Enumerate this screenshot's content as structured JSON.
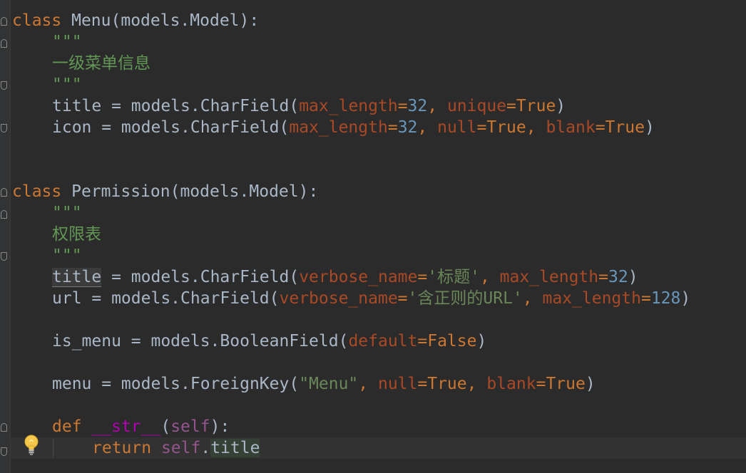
{
  "code": {
    "line1": {
      "kw": "class",
      "name": "Menu",
      "rest": "(models.Model):"
    },
    "line2": "\"\"\"",
    "line3": "一级菜单信息",
    "line4": "\"\"\"",
    "line5": {
      "lhs": "title",
      "mid": " = models.CharField(",
      "p1": "max_length",
      "eq1": "=",
      "n1": "32",
      "sep1": ", ",
      "p2": "unique",
      "eq2": "=",
      "v2": "True",
      "end": ")"
    },
    "line6": {
      "lhs": "icon",
      "mid": " = models.CharField(",
      "p1": "max_length",
      "eq1": "=",
      "n1": "32",
      "sep1": ", ",
      "p2": "null",
      "eq2": "=",
      "v2": "True",
      "sep2": ", ",
      "p3": "blank",
      "eq3": "=",
      "v3": "True",
      "end": ")"
    },
    "line7": {
      "kw": "class",
      "name": "Permission",
      "rest": "(models.Model):"
    },
    "line8": "\"\"\"",
    "line9": "权限表",
    "line10": "\"\"\"",
    "line11": {
      "lhs": "title",
      "mid": " = models.CharField(",
      "p1": "verbose_name",
      "eq1": "=",
      "s1": "'标题'",
      "sep1": ", ",
      "p2": "max_length",
      "eq2": "=",
      "n2": "32",
      "end": ")"
    },
    "line12": {
      "lhs": "url",
      "mid": " = models.CharField(",
      "p1": "verbose_name",
      "eq1": "=",
      "s1": "'含正则的URL'",
      "sep1": ", ",
      "p2": "max_length",
      "eq2": "=",
      "n2": "128",
      "end": ")"
    },
    "line13": {
      "lhs": "is_menu",
      "mid": " = models.BooleanField(",
      "p1": "default",
      "eq1": "=",
      "v1": "False",
      "end": ")"
    },
    "line14": {
      "lhs": "menu",
      "mid": " = models.ForeignKey(",
      "s1": "\"Menu\"",
      "sep1": ", ",
      "p2": "null",
      "eq2": "=",
      "v2": "True",
      "sep2": ", ",
      "p3": "blank",
      "eq3": "=",
      "v3": "True",
      "end": ")"
    },
    "line15": {
      "kw": "def",
      "sp": " ",
      "name": "__str__",
      "open": "(",
      "self": "self",
      "close": "):"
    },
    "line16": {
      "kw": "return",
      "sp": " ",
      "self": "self",
      "dot": ".",
      "attr": "title"
    }
  },
  "icons": {
    "intention": "lightbulb-icon",
    "fold": "fold-marker-icon"
  },
  "colors": {
    "background": "#2b2b2b",
    "keyword": "#cc7832",
    "docstring": "#629755",
    "parameter": "#aa4926",
    "number": "#6897bb",
    "string": "#6a8759",
    "magic_method": "#b200b2",
    "self": "#94558d",
    "default_text": "#a9b7c6"
  }
}
